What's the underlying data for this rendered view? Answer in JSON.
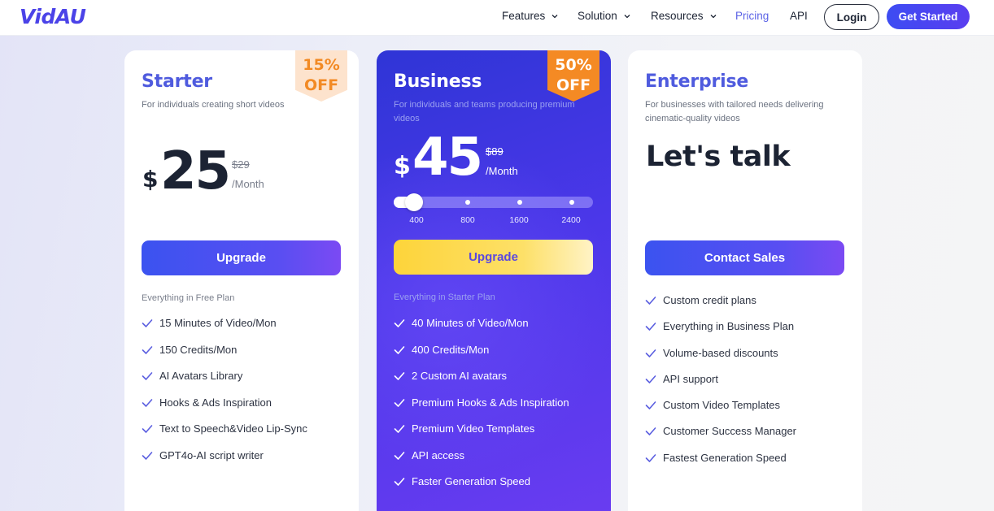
{
  "header": {
    "logo": "VidAU",
    "nav": [
      {
        "label": "Features",
        "dropdown": true
      },
      {
        "label": "Solution",
        "dropdown": true
      },
      {
        "label": "Resources",
        "dropdown": true
      },
      {
        "label": "Pricing",
        "dropdown": false,
        "active": true
      },
      {
        "label": "API",
        "dropdown": false
      }
    ],
    "login": "Login",
    "get_started": "Get Started"
  },
  "plans": {
    "starter": {
      "title": "Starter",
      "desc": "For individuals creating short videos",
      "badge_line1": "15%",
      "badge_line2": "OFF",
      "currency": "$",
      "price": "25",
      "old_price": "$29",
      "period": "/Month",
      "cta": "Upgrade",
      "section_label": "Everything in Free Plan",
      "features": [
        "15 Minutes of Video/Mon",
        "150 Credits/Mon",
        "AI Avatars Library",
        "Hooks & Ads Inspiration",
        "Text to Speech&Video Lip-Sync",
        "GPT4o-AI script writer"
      ]
    },
    "business": {
      "title": "Business",
      "desc": "For individuals and teams producing premium videos",
      "badge_line1": "50%",
      "badge_line2": "OFF",
      "currency": "$",
      "price": "45",
      "old_price": "$89",
      "period": "/Month",
      "slider": {
        "options": [
          "400",
          "800",
          "1600",
          "2400"
        ],
        "selected": "400"
      },
      "cta": "Upgrade",
      "section_label": "Everything in Starter Plan",
      "features": [
        "40 Minutes of Video/Mon",
        "400 Credits/Mon",
        "2 Custom AI avatars",
        "Premium Hooks & Ads Inspiration",
        "Premium Video Templates",
        "API access",
        "Faster Generation Speed"
      ]
    },
    "enterprise": {
      "title": "Enterprise",
      "desc": "For businesses with tailored needs delivering cinematic-quality videos",
      "headline": "Let's talk",
      "cta": "Contact Sales",
      "features": [
        "Custom credit plans",
        "Everything in Business Plan",
        "Volume-based discounts",
        "API support",
        "Custom Video Templates",
        "Customer Success Manager",
        "Fastest Generation Speed"
      ]
    }
  },
  "colors": {
    "brand": "#4b43e8",
    "accent": "#5b63e6",
    "badge_orange": "#f48a24",
    "cta_yellow": "#fdd43a"
  }
}
